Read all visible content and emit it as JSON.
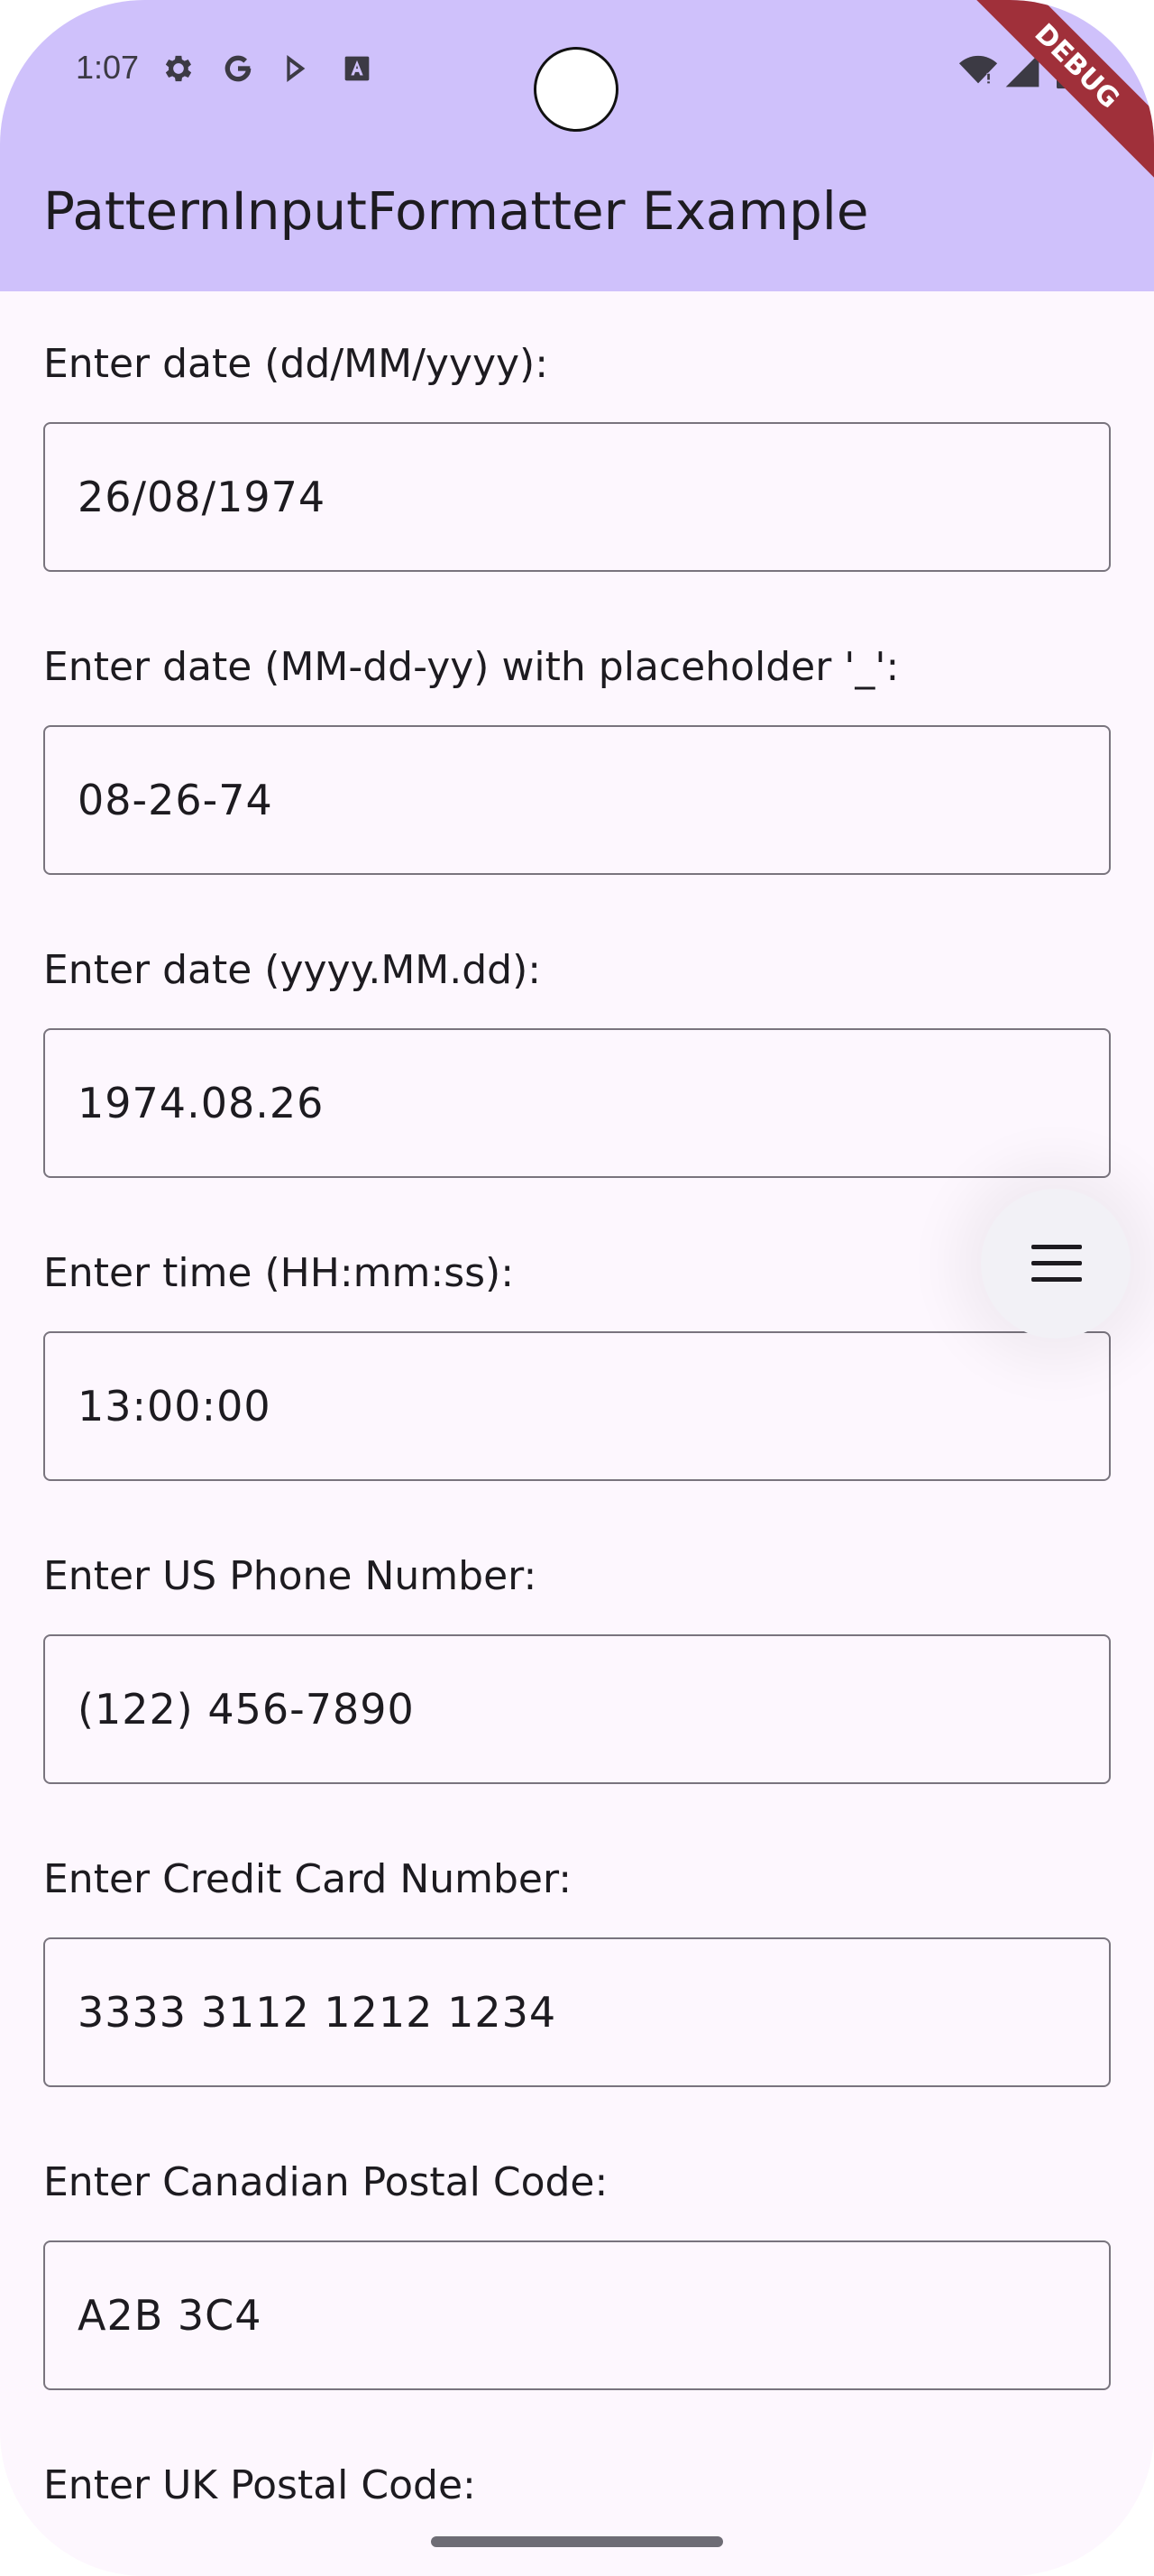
{
  "status_bar": {
    "time": "1:07",
    "left_icons": [
      "settings-icon",
      "google-icon",
      "play-store-icon",
      "text-icon"
    ],
    "right_icons": [
      "wifi-icon",
      "signal-icon",
      "battery-icon"
    ]
  },
  "app_bar": {
    "title": "PatternInputFormatter Example",
    "debug_banner": "DEBUG",
    "color": "#cfc1fb"
  },
  "fields": [
    {
      "label": "Enter date (dd/MM/yyyy):",
      "value": "26/08/1974"
    },
    {
      "label": "Enter date (MM-dd-yy) with placeholder '_':",
      "value": "08-26-74"
    },
    {
      "label": "Enter date (yyyy.MM.dd):",
      "value": "1974.08.26"
    },
    {
      "label": "Enter time (HH:mm:ss):",
      "value": "13:00:00"
    },
    {
      "label": "Enter US Phone Number:",
      "value": "(122) 456-7890"
    },
    {
      "label": "Enter Credit Card Number:",
      "value": "3333 3112 1212 1234"
    },
    {
      "label": "Enter Canadian Postal Code:",
      "value": "A2B 3C4"
    },
    {
      "label": "Enter UK Postal Code:",
      "value": ""
    }
  ],
  "fab": {
    "icon": "menu-icon"
  },
  "colors": {
    "background": "#fdf7fe",
    "border": "#79747e",
    "text": "#1d1b20"
  }
}
